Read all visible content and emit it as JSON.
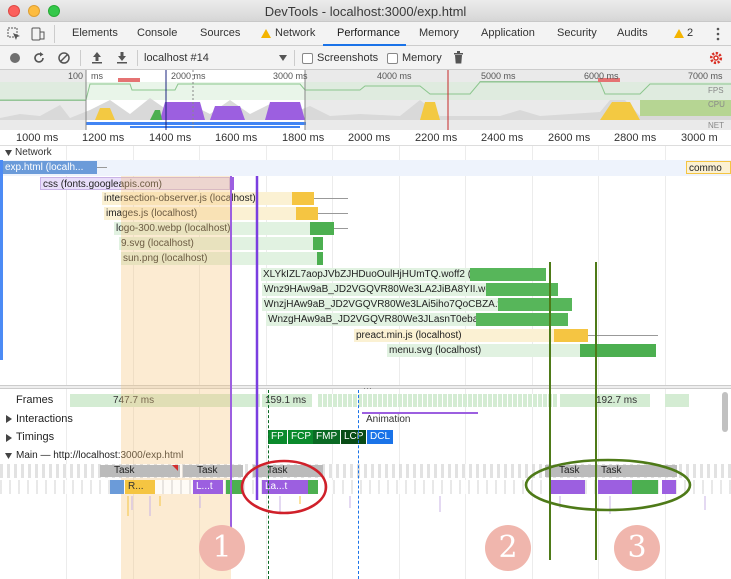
{
  "window": {
    "title": "DevTools - localhost:3000/exp.html"
  },
  "tabs": {
    "elements": "Elements",
    "console": "Console",
    "sources": "Sources",
    "network": "Network",
    "performance": "Performance",
    "memory": "Memory",
    "application": "Application",
    "security": "Security",
    "audits": "Audits",
    "warning_count": "2"
  },
  "toolbar": {
    "profile_select": "localhost #14",
    "screenshots_label": "Screenshots",
    "memory_label": "Memory",
    "screenshots_checked": false,
    "memory_checked": false
  },
  "overview": {
    "ticks": [
      "100",
      "ms",
      "2000 ms",
      "3000 ms",
      "4000 ms",
      "5000 ms",
      "6000 ms",
      "7000 ms"
    ],
    "fps_label": "FPS",
    "cpu_label": "CPU",
    "net_label": "NET"
  },
  "ruler": {
    "ticks": [
      "1000 ms",
      "1200 ms",
      "1400 ms",
      "1600 ms",
      "1800 ms",
      "2000 ms",
      "2200 ms",
      "2400 ms",
      "2600 ms",
      "2800 ms",
      "3000 m"
    ]
  },
  "network": {
    "section_label": "Network",
    "requests": [
      "exp.html (localh...",
      "css (fonts.googleapis.com)",
      "intersection-observer.js (localhost)",
      "images.js (localhost)",
      "logo-300.webp (localhost)",
      "9.svg (localhost)",
      "sun.png (localhost)",
      "XLYkIZL7aopJVbZJHDuoOulHjHUmTQ.woff2 (fonts.gsta...",
      "Wnz9HAw9aB_JD2VGQVR80We3LA2JiBA8YII.woff2 (fonts.g...",
      "WnzjHAw9aB_JD2VGQVR80We3LAi5iho7QoCBZA.woff2 (font...",
      "WnzgHAw9aB_JD2VGQVR80We3JLasnT0ebaiLbBQ.woff2 (fo...",
      "preact.min.js (localhost)",
      "menu.svg (localhost)"
    ],
    "right_label": "commo"
  },
  "tracks": {
    "frames_label": "Frames",
    "frame_values": [
      "747.7 ms",
      "159.1 ms",
      "192.7 ms"
    ],
    "interactions_label": "Interactions",
    "animation_label": "Animation",
    "timings_label": "Timings",
    "timing_markers": [
      "FP",
      "FCP",
      "FMP",
      "LCP",
      "DCL"
    ],
    "main_label": "Main — http://localhost:3000/exp.html",
    "tasks": [
      "Task",
      "Task",
      "Task",
      "Task",
      "Task"
    ],
    "subtasks": [
      "R...",
      "L...t",
      "La...t"
    ]
  },
  "annotations": [
    "1",
    "2",
    "3"
  ],
  "colors": {
    "accent": "#1a73e8",
    "html_blue": "#6b9bd9",
    "css_purple": "#c9b3e6",
    "script_orange": "#f5c542",
    "image_green": "#4caf50",
    "font_green": "#57b65a",
    "purple_task": "#9c5fe0",
    "red_circle": "#d0202a",
    "green_circle": "#4e7a18",
    "annotation_pink": "#f0b6ad"
  }
}
